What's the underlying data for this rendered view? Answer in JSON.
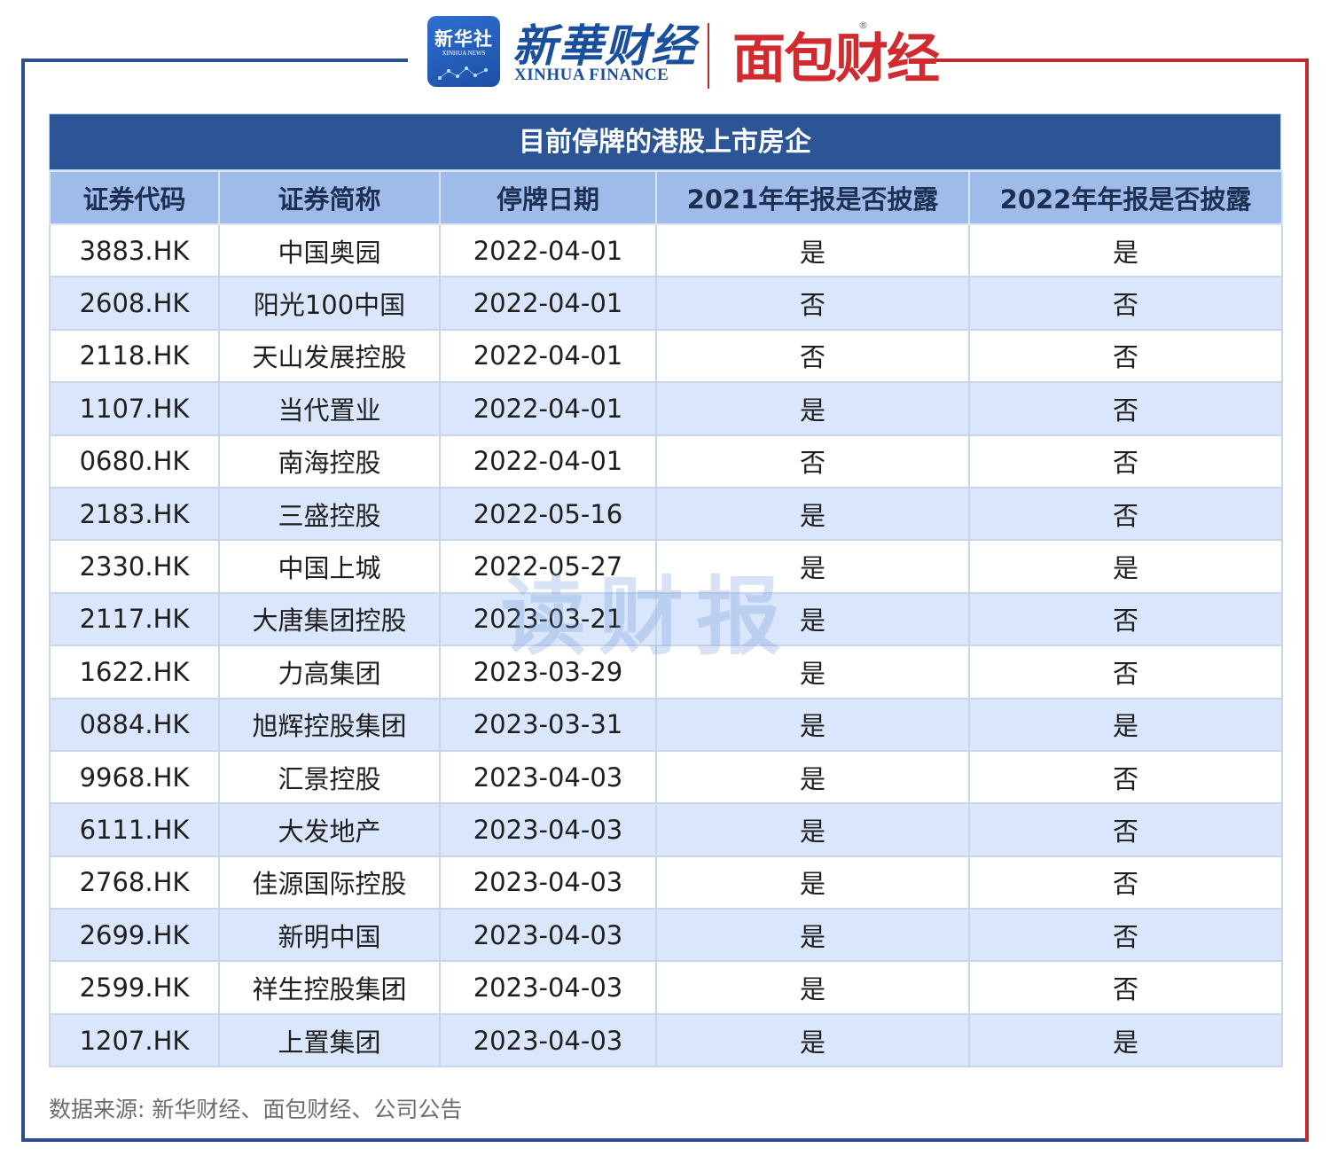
{
  "header": {
    "badge_main": "新华社",
    "badge_sub": "XINHUA NEWS",
    "xinhua_cn": "新華财经",
    "xinhua_en": "XINHUA FINANCE",
    "mianbao": "面包财经",
    "reg_mark": "®"
  },
  "colors": {
    "primary_blue": "#2b5597",
    "header_blue": "#9fbbea",
    "stripe_blue": "#d9e6fb",
    "brand_red": "#d12a2f"
  },
  "table": {
    "title": "目前停牌的港股上市房企",
    "columns": [
      "证券代码",
      "证券简称",
      "停牌日期",
      "2021年年报是否披露",
      "2022年年报是否披露"
    ],
    "rows": [
      [
        "3883.HK",
        "中国奥园",
        "2022-04-01",
        "是",
        "是"
      ],
      [
        "2608.HK",
        "阳光100中国",
        "2022-04-01",
        "否",
        "否"
      ],
      [
        "2118.HK",
        "天山发展控股",
        "2022-04-01",
        "否",
        "否"
      ],
      [
        "1107.HK",
        "当代置业",
        "2022-04-01",
        "是",
        "否"
      ],
      [
        "0680.HK",
        "南海控股",
        "2022-04-01",
        "否",
        "否"
      ],
      [
        "2183.HK",
        "三盛控股",
        "2022-05-16",
        "是",
        "否"
      ],
      [
        "2330.HK",
        "中国上城",
        "2022-05-27",
        "是",
        "是"
      ],
      [
        "2117.HK",
        "大唐集团控股",
        "2023-03-21",
        "是",
        "否"
      ],
      [
        "1622.HK",
        "力高集团",
        "2023-03-29",
        "是",
        "否"
      ],
      [
        "0884.HK",
        "旭辉控股集团",
        "2023-03-31",
        "是",
        "是"
      ],
      [
        "9968.HK",
        "汇景控股",
        "2023-04-03",
        "是",
        "否"
      ],
      [
        "6111.HK",
        "大发地产",
        "2023-04-03",
        "是",
        "否"
      ],
      [
        "2768.HK",
        "佳源国际控股",
        "2023-04-03",
        "是",
        "否"
      ],
      [
        "2699.HK",
        "新明中国",
        "2023-04-03",
        "是",
        "否"
      ],
      [
        "2599.HK",
        "祥生控股集团",
        "2023-04-03",
        "是",
        "否"
      ],
      [
        "1207.HK",
        "上置集团",
        "2023-04-03",
        "是",
        "是"
      ]
    ]
  },
  "watermark": "读财报",
  "source": "数据来源: 新华财经、面包财经、公司公告"
}
